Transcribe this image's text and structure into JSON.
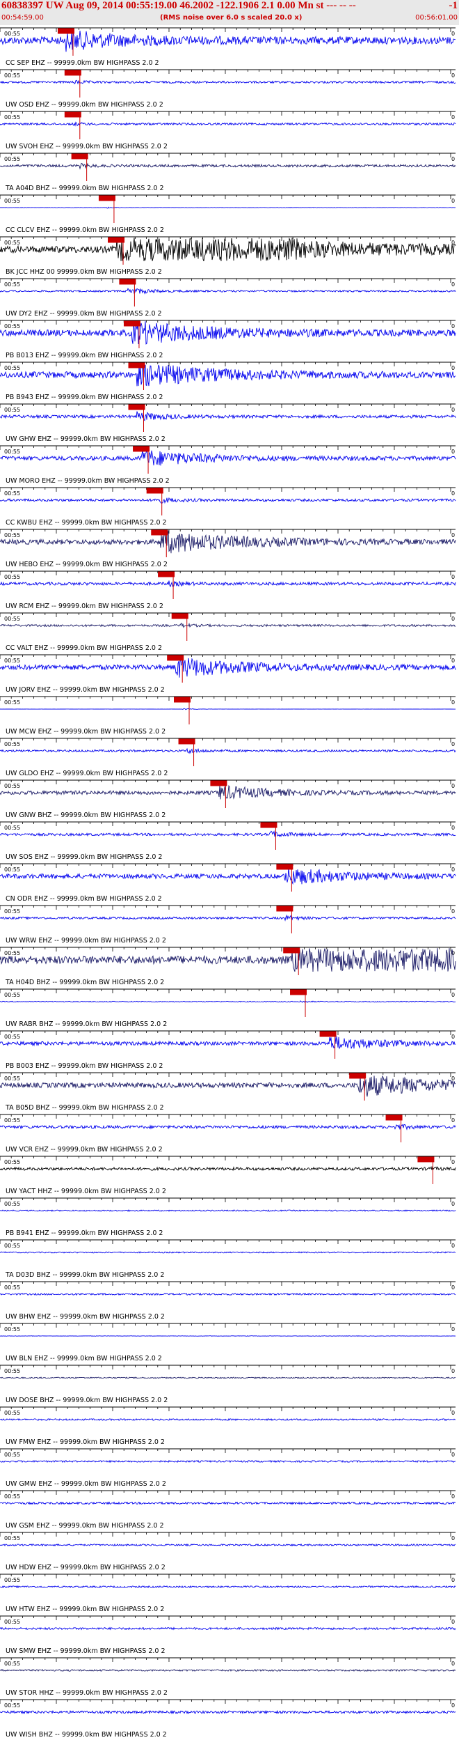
{
  "header": {
    "title": "60838397 UW Aug 09, 2014 00:55:19.00   46.2002 -122.1906  2.1 0.00 Mn st --- -- --",
    "right_marker": "-1",
    "start_time": "00:54:59.00",
    "end_time": "00:56:01.00",
    "note": "(RMS noise over 6.0 s scaled 20.0 x)"
  },
  "colors": {
    "header_text": "#cc0000",
    "trace_blue": "#0000ee",
    "trace_navy": "#1a1a66",
    "trace_black": "#000000",
    "pick_red": "#cc0000"
  },
  "chart_data": {
    "type": "seismogram",
    "x_tick_label": "00:55",
    "x_end_label": "0",
    "traces": [
      {
        "label": "CC SEP EHZ -- 99999.0km BW  HIGHPASS  2.0  2",
        "pick": 0.145,
        "color": "blue",
        "amp": 0.9,
        "burst": 0.3
      },
      {
        "label": "UW OSD EHZ -- 99999.0km BW  HIGHPASS  2.0  2",
        "pick": 0.16,
        "color": "blue",
        "amp": 0.25,
        "burst": 0.06
      },
      {
        "label": "UW SVOH EHZ -- 99999.0km BW  HIGHPASS  2.0  2",
        "pick": 0.16,
        "color": "blue",
        "amp": 0.25,
        "burst": 0.05
      },
      {
        "label": "TA A04D BHZ -- 99999.0km BW  HIGHPASS  2.0  2",
        "pick": 0.175,
        "color": "navy",
        "amp": 0.3,
        "burst": 0.06
      },
      {
        "label": "CC CLCV EHZ -- 99999.0km BW  HIGHPASS  2.0  2",
        "pick": 0.235,
        "color": "blue",
        "amp": 0.05,
        "burst": 0.02
      },
      {
        "label": "BK JCC HHZ 00 99999.0km BW  HIGHPASS  2.0  2",
        "pick": 0.255,
        "color": "black",
        "amp": 0.8,
        "burst": 0.8
      },
      {
        "label": "UW DY2 EHZ -- 99999.0km BW  HIGHPASS  2.0  2",
        "pick": 0.28,
        "color": "blue",
        "amp": 0.2,
        "burst": 0.12
      },
      {
        "label": "PB B013 EHZ -- 99999.0km BW  HIGHPASS  2.0  2",
        "pick": 0.29,
        "color": "blue",
        "amp": 0.75,
        "burst": 0.4
      },
      {
        "label": "PB B943 EHZ -- 99999.0km BW  HIGHPASS  2.0  2",
        "pick": 0.3,
        "color": "blue",
        "amp": 0.75,
        "burst": 0.4
      },
      {
        "label": "UW GHW EHZ -- 99999.0km BW  HIGHPASS  2.0  2",
        "pick": 0.3,
        "color": "blue",
        "amp": 0.35,
        "burst": 0.15
      },
      {
        "label": "UW MORO EHZ -- 99999.0km BW  HIGHPASS  2.0  2",
        "pick": 0.31,
        "color": "blue",
        "amp": 0.5,
        "burst": 0.3
      },
      {
        "label": "CC KWBU EHZ -- 99999.0km BW  HIGHPASS  2.0  2",
        "pick": 0.34,
        "color": "blue",
        "amp": 0.3,
        "burst": 0.1
      },
      {
        "label": "UW HEBO EHZ -- 99999.0km BW  HIGHPASS  2.0  2",
        "pick": 0.35,
        "color": "navy",
        "amp": 0.6,
        "burst": 0.4
      },
      {
        "label": "UW RCM EHZ -- 99999.0km BW  HIGHPASS  2.0  2",
        "pick": 0.365,
        "color": "blue",
        "amp": 0.35,
        "burst": 0.08
      },
      {
        "label": "CC VALT EHZ -- 99999.0km BW  HIGHPASS  2.0  2",
        "pick": 0.395,
        "color": "navy",
        "amp": 0.25,
        "burst": 0.06
      },
      {
        "label": "UW JORV EHZ -- 99999.0km BW  HIGHPASS  2.0  2",
        "pick": 0.385,
        "color": "blue",
        "amp": 0.6,
        "burst": 0.35
      },
      {
        "label": "UW MCW EHZ -- 99999.0km BW  HIGHPASS  2.0  2",
        "pick": 0.4,
        "color": "blue",
        "amp": 0.02,
        "burst": 0.03
      },
      {
        "label": "UW GLDO EHZ -- 99999.0km BW  HIGHPASS  2.0  2",
        "pick": 0.41,
        "color": "blue",
        "amp": 0.25,
        "burst": 0.08
      },
      {
        "label": "UW GNW BHZ -- 99999.0km BW  HIGHPASS  2.0  2",
        "pick": 0.48,
        "color": "navy",
        "amp": 0.45,
        "burst": 0.25
      },
      {
        "label": "UW SOS EHZ -- 99999.0km BW  HIGHPASS  2.0  2",
        "pick": 0.59,
        "color": "blue",
        "amp": 0.3,
        "burst": 0.1
      },
      {
        "label": "CN ODR EHZ -- 99999.0km BW  HIGHPASS  2.0  2",
        "pick": 0.625,
        "color": "blue",
        "amp": 0.55,
        "burst": 0.3
      },
      {
        "label": "UW WRW EHZ -- 99999.0km BW  HIGHPASS  2.0  2",
        "pick": 0.625,
        "color": "blue",
        "amp": 0.25,
        "burst": 0.08
      },
      {
        "label": "TA H04D BHZ -- 99999.0km BW  HIGHPASS  2.0  2",
        "pick": 0.64,
        "color": "navy",
        "amp": 0.95,
        "burst": 1.0
      },
      {
        "label": "UW RABR BHZ -- 99999.0km BW  HIGHPASS  2.0  2",
        "pick": 0.655,
        "color": "blue",
        "amp": 0.1,
        "burst": 0.04
      },
      {
        "label": "PB B003 EHZ -- 99999.0km BW  HIGHPASS  2.0  2",
        "pick": 0.72,
        "color": "blue",
        "amp": 0.45,
        "burst": 0.25
      },
      {
        "label": "TA B05D BHZ -- 99999.0km BW  HIGHPASS  2.0  2",
        "pick": 0.785,
        "color": "navy",
        "amp": 0.6,
        "burst": 0.4
      },
      {
        "label": "UW VCR EHZ -- 99999.0km BW  HIGHPASS  2.0  2",
        "pick": 0.865,
        "color": "blue",
        "amp": 0.35,
        "burst": 0.08
      },
      {
        "label": "UW YACT HHZ -- 99999.0km BW  HIGHPASS  2.0  2",
        "pick": 0.935,
        "color": "black",
        "amp": 0.35,
        "burst": 0.05
      },
      {
        "label": "PB B941 EHZ -- 99999.0km BW  HIGHPASS  2.0  2",
        "pick": null,
        "color": "blue",
        "amp": 0.15,
        "burst": 0
      },
      {
        "label": "TA D03D BHZ -- 99999.0km BW  HIGHPASS  2.0  2",
        "pick": null,
        "color": "blue",
        "amp": 0.15,
        "burst": 0
      },
      {
        "label": "UW BHW EHZ -- 99999.0km BW  HIGHPASS  2.0  2",
        "pick": null,
        "color": "blue",
        "amp": 0.2,
        "burst": 0
      },
      {
        "label": "UW BLN EHZ -- 99999.0km BW  HIGHPASS  2.0  2",
        "pick": null,
        "color": "blue",
        "amp": 0.05,
        "burst": 0
      },
      {
        "label": "UW DOSE BHZ -- 99999.0km BW  HIGHPASS  2.0  2",
        "pick": null,
        "color": "navy",
        "amp": 0.15,
        "burst": 0
      },
      {
        "label": "UW FMW EHZ -- 99999.0km BW  HIGHPASS  2.0  2",
        "pick": null,
        "color": "blue",
        "amp": 0.2,
        "burst": 0
      },
      {
        "label": "UW GMW EHZ -- 99999.0km BW  HIGHPASS  2.0  2",
        "pick": null,
        "color": "blue",
        "amp": 0.2,
        "burst": 0
      },
      {
        "label": "UW GSM EHZ -- 99999.0km BW  HIGHPASS  2.0  2",
        "pick": null,
        "color": "blue",
        "amp": 0.25,
        "burst": 0
      },
      {
        "label": "UW HDW EHZ -- 99999.0km BW  HIGHPASS  2.0  2",
        "pick": null,
        "color": "blue",
        "amp": 0.2,
        "burst": 0
      },
      {
        "label": "UW HTW EHZ -- 99999.0km BW  HIGHPASS  2.0  2",
        "pick": null,
        "color": "blue",
        "amp": 0.2,
        "burst": 0
      },
      {
        "label": "UW SMW EHZ -- 99999.0km BW  HIGHPASS  2.0  2",
        "pick": null,
        "color": "blue",
        "amp": 0.25,
        "burst": 0
      },
      {
        "label": "UW STOR HHZ -- 99999.0km BW  HIGHPASS  2.0  2",
        "pick": null,
        "color": "navy",
        "amp": 0.2,
        "burst": 0
      },
      {
        "label": "UW WISH BHZ -- 99999.0km BW  HIGHPASS  2.0  2",
        "pick": null,
        "color": "blue",
        "amp": 0.3,
        "burst": 0
      }
    ]
  }
}
